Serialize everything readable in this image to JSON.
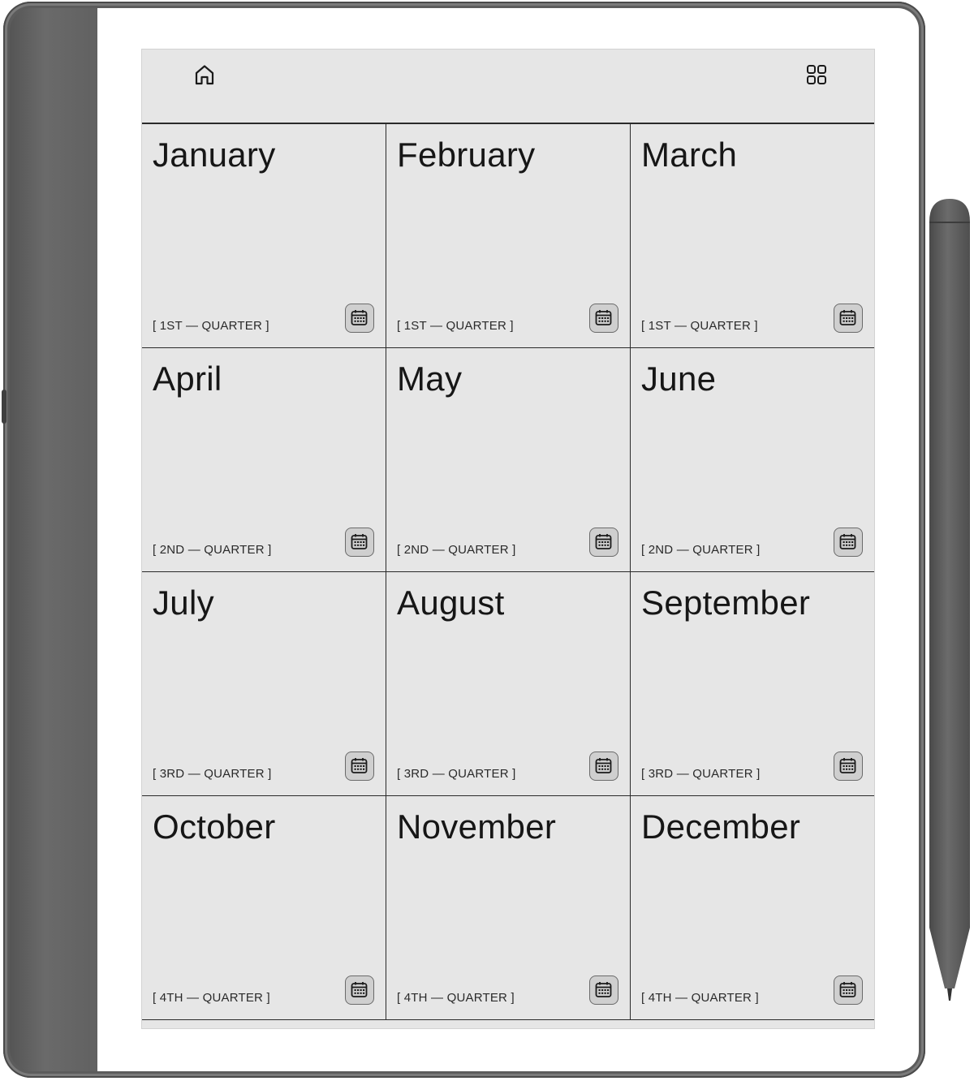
{
  "toolbar": {
    "home_icon": "home-icon",
    "view_icon": "grid-view-icon"
  },
  "months": [
    {
      "name": "January",
      "quarter": "[ 1ST — QUARTER ]"
    },
    {
      "name": "February",
      "quarter": "[ 1ST — QUARTER ]"
    },
    {
      "name": "March",
      "quarter": "[ 1ST — QUARTER ]"
    },
    {
      "name": "April",
      "quarter": "[ 2ND — QUARTER ]"
    },
    {
      "name": "May",
      "quarter": "[ 2ND — QUARTER ]"
    },
    {
      "name": "June",
      "quarter": "[ 2ND — QUARTER ]"
    },
    {
      "name": "July",
      "quarter": "[ 3RD — QUARTER ]"
    },
    {
      "name": "August",
      "quarter": "[ 3RD — QUARTER ]"
    },
    {
      "name": "September",
      "quarter": "[ 3RD — QUARTER ]"
    },
    {
      "name": "October",
      "quarter": "[ 4TH — QUARTER ]"
    },
    {
      "name": "November",
      "quarter": "[ 4TH — QUARTER ]"
    },
    {
      "name": "December",
      "quarter": "[ 4TH — QUARTER ]"
    }
  ],
  "colors": {
    "screen": "#e6e6e6",
    "device": "#5c5c5c",
    "stylus": "#5a5a5a",
    "ink": "#161616"
  }
}
